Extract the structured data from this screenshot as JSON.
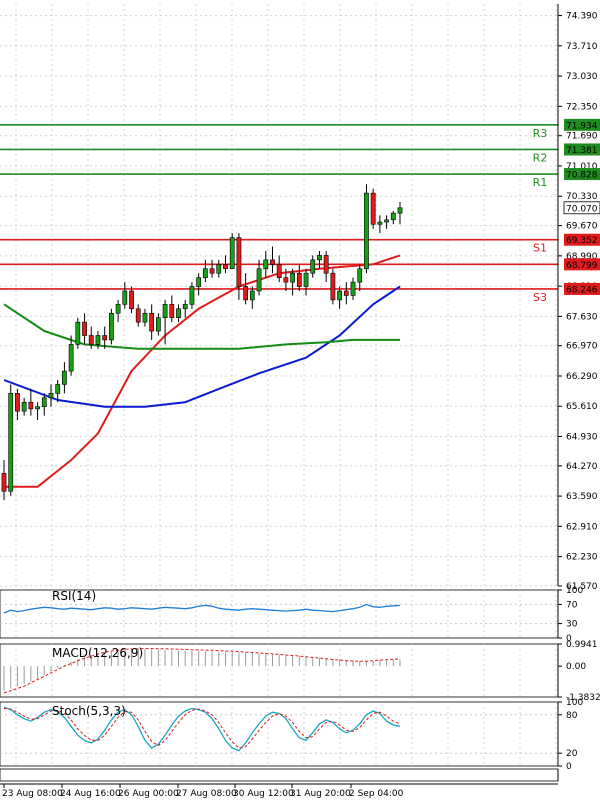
{
  "chart_data": {
    "type": "candlestick",
    "price_axis_ticks": [
      "74.390",
      "73.710",
      "73.030",
      "72.350",
      "71.690",
      "71.010",
      "70.330",
      "69.670",
      "68.990",
      "68.310",
      "67.630",
      "66.970",
      "66.290",
      "65.610",
      "64.930",
      "64.270",
      "63.590",
      "62.910",
      "62.230",
      "61.570"
    ],
    "price_range": [
      61.57,
      74.65
    ],
    "current_price": {
      "label": "70.070",
      "value": 70.07
    },
    "levels": [
      {
        "name": "R3",
        "label": "71.934",
        "value": 71.934,
        "color": "#1e8c1e"
      },
      {
        "name": "R2",
        "label": "71.381",
        "value": 71.381,
        "color": "#1e8c1e"
      },
      {
        "name": "R1",
        "label": "70.828",
        "value": 70.828,
        "color": "#1e8c1e"
      },
      {
        "name": "S1",
        "label": "69.352",
        "value": 69.352,
        "color": "#e01b1b"
      },
      {
        "name": "",
        "label": "68.799",
        "value": 68.799,
        "color": "#e01b1b"
      },
      {
        "name": "S3",
        "label": "68.246",
        "value": 68.246,
        "color": "#e01b1b"
      }
    ],
    "candles": [
      [
        64.1,
        64.4,
        63.5,
        63.7
      ],
      [
        63.7,
        66.1,
        63.6,
        65.9
      ],
      [
        65.9,
        66.0,
        65.3,
        65.5
      ],
      [
        65.5,
        65.8,
        65.4,
        65.7
      ],
      [
        65.7,
        66.0,
        65.4,
        65.55
      ],
      [
        65.55,
        65.7,
        65.3,
        65.6
      ],
      [
        65.6,
        65.9,
        65.4,
        65.8
      ],
      [
        65.8,
        66.1,
        65.6,
        65.9
      ],
      [
        65.9,
        66.2,
        65.7,
        66.1
      ],
      [
        66.1,
        66.6,
        65.9,
        66.4
      ],
      [
        66.4,
        67.2,
        66.3,
        67.0
      ],
      [
        67.0,
        67.6,
        66.9,
        67.5
      ],
      [
        67.5,
        67.7,
        67.0,
        67.2
      ],
      [
        67.2,
        67.4,
        66.9,
        67.0
      ],
      [
        67.0,
        67.3,
        66.9,
        67.2
      ],
      [
        67.2,
        67.4,
        66.9,
        67.1
      ],
      [
        67.1,
        67.8,
        67.0,
        67.7
      ],
      [
        67.7,
        68.0,
        67.5,
        67.9
      ],
      [
        67.9,
        68.4,
        67.8,
        68.2
      ],
      [
        68.2,
        68.3,
        67.7,
        67.8
      ],
      [
        67.8,
        67.9,
        67.4,
        67.5
      ],
      [
        67.5,
        67.8,
        67.4,
        67.7
      ],
      [
        67.7,
        67.9,
        67.1,
        67.3
      ],
      [
        67.3,
        67.7,
        67.2,
        67.6
      ],
      [
        67.6,
        68.0,
        67.0,
        67.9
      ],
      [
        67.9,
        68.1,
        67.5,
        67.6
      ],
      [
        67.6,
        67.9,
        67.5,
        67.8
      ],
      [
        67.8,
        68.0,
        67.6,
        67.9
      ],
      [
        67.9,
        68.4,
        67.8,
        68.3
      ],
      [
        68.3,
        68.6,
        68.1,
        68.5
      ],
      [
        68.5,
        68.9,
        68.4,
        68.7
      ],
      [
        68.7,
        68.9,
        68.5,
        68.6
      ],
      [
        68.6,
        68.9,
        68.5,
        68.8
      ],
      [
        68.8,
        69.0,
        68.6,
        68.7
      ],
      [
        68.7,
        69.5,
        68.7,
        69.4
      ],
      [
        69.4,
        69.5,
        68.0,
        68.3
      ],
      [
        68.3,
        68.6,
        67.9,
        68.0
      ],
      [
        68.0,
        68.3,
        67.8,
        68.2
      ],
      [
        68.2,
        68.9,
        68.1,
        68.7
      ],
      [
        68.7,
        69.1,
        68.5,
        68.9
      ],
      [
        68.9,
        69.2,
        68.6,
        68.8
      ],
      [
        68.8,
        69.0,
        68.4,
        68.5
      ],
      [
        68.5,
        68.7,
        68.2,
        68.4
      ],
      [
        68.4,
        68.7,
        68.1,
        68.6
      ],
      [
        68.6,
        68.8,
        68.2,
        68.3
      ],
      [
        68.3,
        68.7,
        68.1,
        68.6
      ],
      [
        68.6,
        69.0,
        68.5,
        68.9
      ],
      [
        68.9,
        69.1,
        68.7,
        69.0
      ],
      [
        69.0,
        69.1,
        68.4,
        68.6
      ],
      [
        68.6,
        68.7,
        67.9,
        68.0
      ],
      [
        68.0,
        68.3,
        67.8,
        68.2
      ],
      [
        68.2,
        68.4,
        67.9,
        68.1
      ],
      [
        68.1,
        68.5,
        68.0,
        68.4
      ],
      [
        68.4,
        68.8,
        68.2,
        68.7
      ],
      [
        68.7,
        70.6,
        68.6,
        70.4
      ],
      [
        70.4,
        70.5,
        69.6,
        69.7
      ],
      [
        69.7,
        69.9,
        69.5,
        69.75
      ],
      [
        69.75,
        69.9,
        69.6,
        69.8
      ],
      [
        69.8,
        70.0,
        69.7,
        69.95
      ],
      [
        69.95,
        70.2,
        69.7,
        70.07
      ]
    ],
    "ma_lines": [
      {
        "color": "#e01b1b",
        "values": [
          [
            0,
            63.8
          ],
          [
            5,
            63.8
          ],
          [
            10,
            64.4
          ],
          [
            14,
            65.0
          ],
          [
            19,
            66.4
          ],
          [
            24,
            67.2
          ],
          [
            29,
            67.8
          ],
          [
            35,
            68.3
          ],
          [
            41,
            68.6
          ],
          [
            47,
            68.7
          ],
          [
            51,
            68.75
          ],
          [
            55,
            68.8
          ],
          [
            59,
            69.0
          ]
        ]
      },
      {
        "color": "#0a1ad2",
        "values": [
          [
            0,
            66.2
          ],
          [
            8,
            65.75
          ],
          [
            15,
            65.6
          ],
          [
            21,
            65.6
          ],
          [
            27,
            65.7
          ],
          [
            32,
            66.0
          ],
          [
            38,
            66.35
          ],
          [
            45,
            66.7
          ],
          [
            50,
            67.2
          ],
          [
            55,
            67.9
          ],
          [
            59,
            68.3
          ]
        ]
      },
      {
        "color": "#148c14",
        "values": [
          [
            0,
            67.9
          ],
          [
            6,
            67.3
          ],
          [
            12,
            67.0
          ],
          [
            20,
            66.9
          ],
          [
            28,
            66.9
          ],
          [
            35,
            66.9
          ],
          [
            42,
            67.0
          ],
          [
            48,
            67.05
          ],
          [
            52,
            67.1
          ],
          [
            59,
            67.1
          ]
        ]
      }
    ],
    "rsi": {
      "title": "RSI(14)",
      "ticks": [
        "100",
        "70",
        "30",
        "0"
      ],
      "range": [
        0,
        100
      ],
      "color": "#1f7fd4",
      "values": [
        52,
        58,
        55,
        57,
        60,
        62,
        64,
        63,
        61,
        60,
        62,
        61,
        60,
        59,
        61,
        63,
        62,
        60,
        61,
        63,
        62,
        61,
        60,
        62,
        64,
        63,
        62,
        61,
        63,
        66,
        68,
        66,
        62,
        60,
        59,
        58,
        60,
        61,
        60,
        59,
        58,
        57,
        56,
        57,
        58,
        60,
        58,
        57,
        56,
        55,
        57,
        59,
        61,
        64,
        70,
        65,
        64,
        66,
        67,
        68
      ]
    },
    "macd": {
      "title": "MACD(12,26,9)",
      "ticks": [
        "0.9941",
        "0.00",
        "-1.3832"
      ],
      "range": [
        -1.3832,
        0.9941
      ],
      "histogram": [
        -1.1,
        -1.0,
        -0.9,
        -0.8,
        -0.7,
        -0.55,
        -0.4,
        -0.25,
        -0.1,
        0.05,
        0.2,
        0.3,
        0.4,
        0.48,
        0.55,
        0.6,
        0.65,
        0.7,
        0.72,
        0.75,
        0.76,
        0.76,
        0.75,
        0.73,
        0.72,
        0.7,
        0.7,
        0.69,
        0.68,
        0.68,
        0.67,
        0.66,
        0.65,
        0.64,
        0.63,
        0.62,
        0.6,
        0.58,
        0.56,
        0.55,
        0.53,
        0.52,
        0.5,
        0.48,
        0.45,
        0.43,
        0.4,
        0.38,
        0.35,
        0.33,
        0.3,
        0.28,
        0.25,
        0.23,
        0.22,
        0.23,
        0.25,
        0.27,
        0.29,
        0.3
      ],
      "signal": [
        -1.2,
        -1.1,
        -1.0,
        -0.9,
        -0.75,
        -0.6,
        -0.45,
        -0.3,
        -0.15,
        0.0,
        0.12,
        0.25,
        0.35,
        0.45,
        0.55,
        0.62,
        0.68,
        0.72,
        0.75,
        0.77,
        0.78,
        0.79,
        0.79,
        0.78,
        0.78,
        0.77,
        0.76,
        0.75,
        0.74,
        0.73,
        0.72,
        0.71,
        0.7,
        0.68,
        0.67,
        0.65,
        0.63,
        0.61,
        0.59,
        0.57,
        0.55,
        0.53,
        0.5,
        0.48,
        0.45,
        0.42,
        0.39,
        0.36,
        0.33,
        0.3,
        0.27,
        0.25,
        0.23,
        0.22,
        0.22,
        0.24,
        0.27,
        0.29,
        0.31,
        0.33
      ]
    },
    "stoch": {
      "title": "Stoch(5,3,3)",
      "ticks": [
        "100",
        "80",
        "20",
        "0"
      ],
      "range": [
        0,
        100
      ],
      "main_color": "#1ba6c4",
      "signal_color": "#e01b1b",
      "main": [
        92,
        88,
        80,
        74,
        70,
        76,
        84,
        88,
        85,
        76,
        62,
        48,
        40,
        36,
        42,
        56,
        72,
        84,
        88,
        80,
        62,
        40,
        28,
        34,
        48,
        64,
        78,
        86,
        90,
        88,
        84,
        74,
        58,
        40,
        28,
        24,
        36,
        52,
        66,
        78,
        84,
        82,
        74,
        58,
        44,
        40,
        52,
        66,
        72,
        68,
        58,
        52,
        56,
        66,
        80,
        86,
        82,
        70,
        64,
        62
      ],
      "signal": [
        90,
        89,
        84,
        78,
        73,
        74,
        80,
        86,
        87,
        82,
        72,
        58,
        48,
        40,
        40,
        48,
        62,
        76,
        85,
        84,
        72,
        54,
        38,
        32,
        40,
        54,
        68,
        80,
        87,
        89,
        86,
        80,
        68,
        52,
        38,
        28,
        30,
        42,
        56,
        68,
        78,
        82,
        78,
        68,
        54,
        44,
        46,
        58,
        68,
        70,
        64,
        56,
        54,
        60,
        72,
        82,
        84,
        78,
        70,
        66
      ]
    },
    "time_labels": [
      "23 Aug 08:00",
      "24 Aug 16:00",
      "26 Aug 00:00",
      "27 Aug 08:00",
      "30 Aug 12:00",
      "31 Aug 20:00",
      "2 Sep 04:00"
    ]
  }
}
